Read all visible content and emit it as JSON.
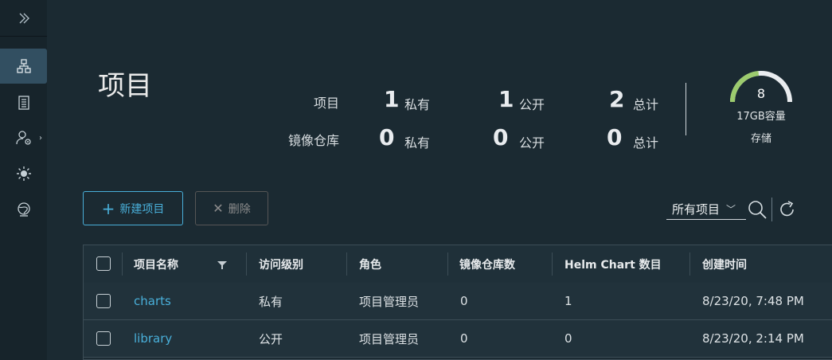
{
  "sidebar": {
    "items": [
      {
        "name": "projects",
        "icon": "sitemap-icon",
        "active": true
      },
      {
        "name": "logs",
        "icon": "document-list-icon",
        "active": false
      },
      {
        "name": "admin",
        "icon": "user-settings-icon",
        "active": false
      },
      {
        "name": "theme",
        "icon": "sun-icon",
        "active": false
      },
      {
        "name": "api",
        "icon": "globe-icon",
        "active": false
      }
    ]
  },
  "page": {
    "title": "项目"
  },
  "stats": {
    "row_labels": [
      "项目",
      "镜像仓库"
    ],
    "projects": {
      "private": "1",
      "private_label": "私有",
      "public": "1",
      "public_label": "公开",
      "total": "2",
      "total_label": "总计"
    },
    "repos": {
      "private": "0",
      "private_label": "私有",
      "public": "0",
      "public_label": "公开",
      "total": "0",
      "total_label": "总计"
    }
  },
  "storage": {
    "value": "8",
    "capacity": "17GB容量",
    "label": "存储",
    "gauge_color": "#9ccb6e",
    "fill_fraction": 0.47
  },
  "toolbar": {
    "new_label": "新建项目",
    "delete_label": "删除",
    "filter_value": "所有项目"
  },
  "table": {
    "columns": [
      "项目名称",
      "访问级别",
      "角色",
      "镜像仓库数",
      "Helm Chart 数目",
      "创建时间"
    ],
    "rows": [
      {
        "name": "charts",
        "access": "私有",
        "role": "项目管理员",
        "repos": "0",
        "charts": "1",
        "created": "8/23/20, 7:48 PM"
      },
      {
        "name": "library",
        "access": "公开",
        "role": "项目管理员",
        "repos": "0",
        "charts": "0",
        "created": "8/23/20, 2:14 PM"
      }
    ]
  },
  "colors": {
    "accent": "#49afd9",
    "background": "#1b2a32",
    "sidebar": "#17242b"
  }
}
